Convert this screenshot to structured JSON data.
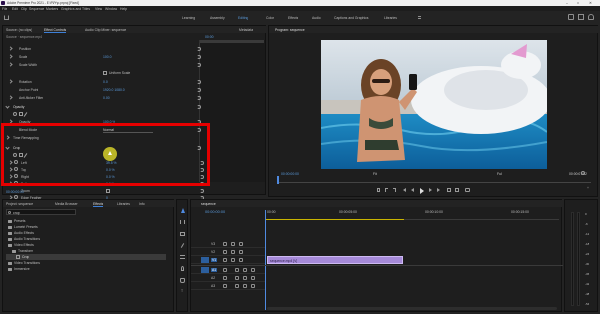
{
  "window": {
    "title": "Adobe Premiere Pro 2021 - E:\\F\\Pr\\p.prproj [Fixed]",
    "controls": [
      "–",
      "□",
      "✕"
    ]
  },
  "menu": [
    "File",
    "Edit",
    "Clip",
    "Sequence",
    "Markers",
    "Graphics and Titles",
    "View",
    "Window",
    "Help"
  ],
  "workspaces": [
    "Learning",
    "Assembly",
    "Editing",
    "Color",
    "Effects",
    "Audio",
    "Captions and Graphics",
    "Libraries"
  ],
  "source_tabs": [
    "Source: (no clips)",
    "Effect Controls",
    "Audio Clip Mixer: sequence",
    "Metadata"
  ],
  "effect_controls": {
    "clip_name": "Source · sequence.mp4",
    "timecode": "00:00",
    "rows": [
      {
        "label": "Position",
        "value": ""
      },
      {
        "label": "Scale",
        "value": "100.0"
      },
      {
        "label": "Scale Width",
        "value": ""
      },
      {
        "label": "",
        "value": "Uniform Scale"
      },
      {
        "label": "Rotation",
        "value": "0.0"
      },
      {
        "label": "Anchor Point",
        "value": "1920.0  1080.0"
      },
      {
        "label": "Anti-flicker Filter",
        "value": "0.00"
      },
      {
        "label": "Opacity",
        "value": ""
      },
      {
        "label": "Opacity",
        "value": "100.0 %"
      },
      {
        "label": "Blend Mode",
        "value": "Normal"
      },
      {
        "label": "Time Remapping",
        "value": ""
      }
    ],
    "crop": {
      "title": "Crop",
      "rows": [
        {
          "label": "Left",
          "value": "39.5 %"
        },
        {
          "label": "Top",
          "value": "0.0 %"
        },
        {
          "label": "Right",
          "value": "0.0 %"
        },
        {
          "label": "Bottom",
          "value": "0.0 %"
        },
        {
          "label": "Zoom",
          "value": ""
        },
        {
          "label": "Edge Feather",
          "value": "0"
        }
      ]
    },
    "footer_time": "00:00:00:00"
  },
  "program": {
    "tab": "Program: sequence",
    "current_time": "00:00:00:00",
    "fit": "Fit",
    "quality": "Full",
    "duration": "00:00:07:02"
  },
  "project": {
    "tabs": [
      "Project: sequence",
      "Media Browser",
      "Effects",
      "Libraries",
      "Info"
    ],
    "search_placeholder": "crop",
    "tree": [
      {
        "label": "Presets",
        "indent": 0
      },
      {
        "label": "Lumetri Presets",
        "indent": 0
      },
      {
        "label": "Audio Effects",
        "indent": 0
      },
      {
        "label": "Audio Transitions",
        "indent": 0
      },
      {
        "label": "Video Effects",
        "indent": 0
      },
      {
        "label": "Transform",
        "indent": 1
      },
      {
        "label": "Crop",
        "indent": 2
      },
      {
        "label": "Video Transitions",
        "indent": 0
      },
      {
        "label": "Immersive",
        "indent": 0
      }
    ]
  },
  "timeline": {
    "tab": "sequence",
    "timecode": "00:00:00:00",
    "ruler": [
      "00:00",
      "00:00:05:00",
      "00:00:10:00",
      "00:00:15:00"
    ],
    "tracks": [
      "V3",
      "V2",
      "V1",
      "A1",
      "A2",
      "A3"
    ],
    "clip_label": "sequence.mp4 [V]"
  },
  "meter_labels": [
    "0",
    "-6",
    "-12",
    "-18",
    "-24",
    "-30",
    "-36",
    "-42",
    "-48",
    "-54"
  ],
  "colors": {
    "highlight_red": "#e60000",
    "timecode_blue": "#4f8ae0",
    "clip_purple": "#a68ad8",
    "cursor_yellow": "#d6d02a"
  }
}
